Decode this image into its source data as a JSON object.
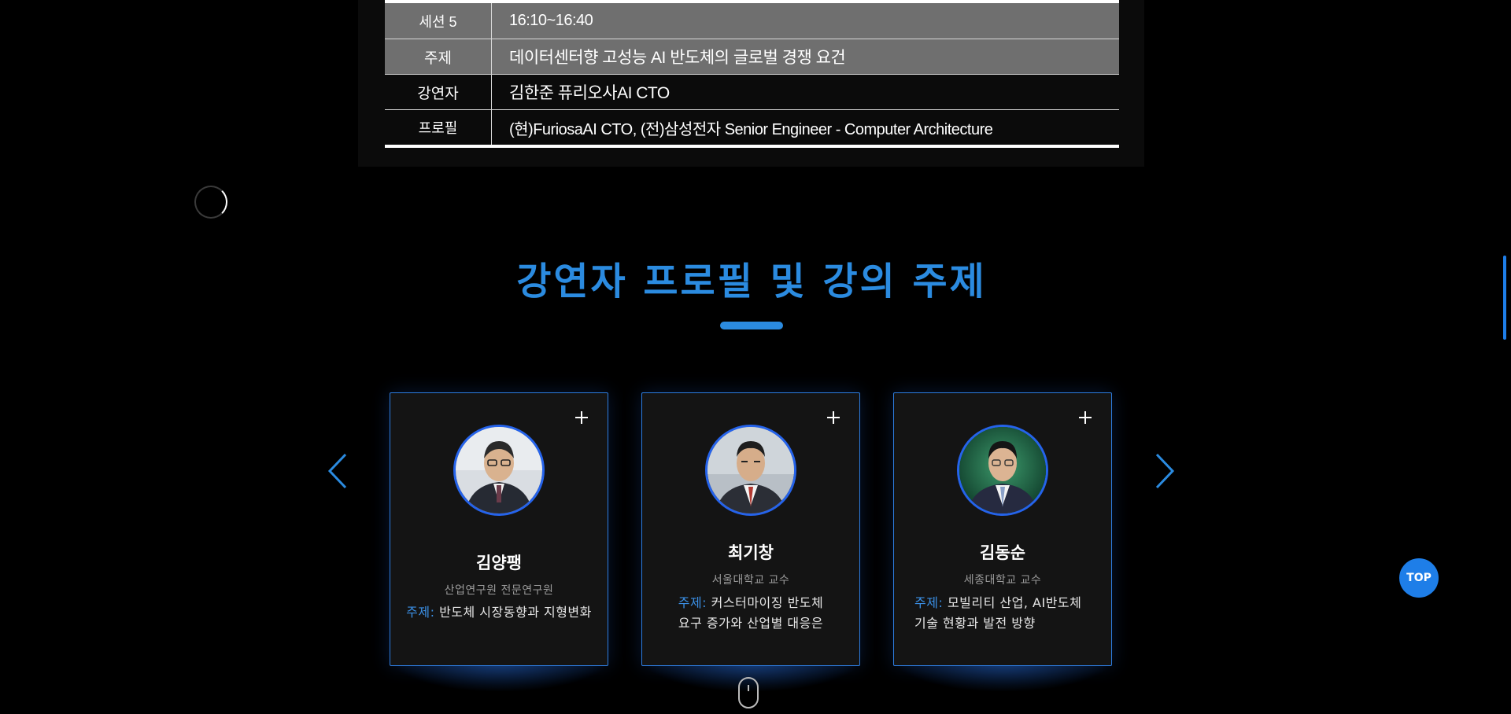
{
  "session": {
    "rows": [
      {
        "label": "세션 5",
        "value": "16:10~16:40"
      },
      {
        "label": "주제",
        "value": "데이터센터향 고성능 AI 반도체의 글로벌 경쟁 요건"
      },
      {
        "label": "강연자",
        "value": "김한준 퓨리오사AI CTO"
      },
      {
        "label": "프로필",
        "value": "(현)FuriosaAI CTO, (전)삼성전자 Senior Engineer - Computer Architecture"
      }
    ]
  },
  "section": {
    "title": "강연자 프로필 및 강의 주제"
  },
  "speakers": [
    {
      "name": "김양팽",
      "org": "산업연구원 전문연구원",
      "topic_key": "주제:",
      "topic": "반도체 시장동향과 지형변화"
    },
    {
      "name": "최기창",
      "org": "서울대학교 교수",
      "topic_key": "주제:",
      "topic_line1": "커스터마이징 반도체",
      "topic_line2": "요구 증가와 산업별 대응은"
    },
    {
      "name": "김동순",
      "org": "세종대학교 교수",
      "topic_key": "주제:",
      "topic_line1": "모빌리티 산업, AI반도체",
      "topic_line2": "기술 현황과 발전 방향"
    }
  ],
  "top_button": {
    "label": "TOP"
  },
  "colors": {
    "accent": "#2b8be0",
    "card_border": "#2d7de0",
    "table_highlight": "#6f6f6f"
  },
  "icons": {
    "prev": "chevron-left-icon",
    "next": "chevron-right-icon",
    "plus": "plus-icon",
    "scroll": "mouse-scroll-icon",
    "loading": "spinner-icon"
  }
}
